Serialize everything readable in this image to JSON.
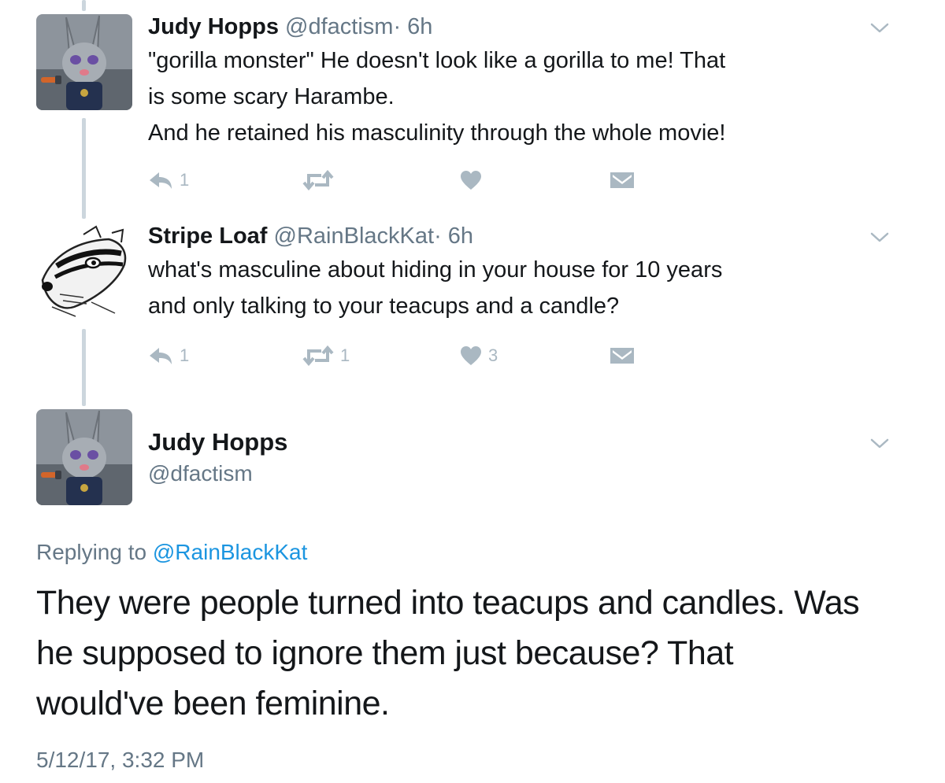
{
  "tweets": [
    {
      "name": "Judy Hopps",
      "handle": "@dfactism",
      "time": "· 6h",
      "lines": [
        "\"gorilla monster\" He doesn't look like a gorilla to me! That",
        "is some scary Harambe.",
        "And he retained his masculinity through the whole movie!"
      ],
      "reply_count": "1",
      "retweet_count": "",
      "like_count": "",
      "avatar_icon": "judy-hopps-avatar"
    },
    {
      "name": "Stripe Loaf",
      "handle": "@RainBlackKat",
      "time": "· 6h",
      "lines": [
        "what's masculine about hiding in your house for 10 years",
        "and only talking to your teacups and a candle?"
      ],
      "reply_count": "1",
      "retweet_count": "1",
      "like_count": "3",
      "avatar_icon": "badger-sketch-avatar"
    }
  ],
  "main_tweet": {
    "name": "Judy Hopps",
    "handle": "@dfactism",
    "replying_prefix": "Replying to",
    "replying_to": "@RainBlackKat",
    "text_lines": [
      "They were people turned into teacups and candles. Was",
      "he supposed to ignore them just because? That",
      "would've been feminine."
    ],
    "timestamp": "5/12/17, 3:32 PM"
  },
  "colors": {
    "text": "#14171a",
    "secondary": "#657786",
    "icon": "#aab8c2",
    "link": "#1b95e0",
    "thread_line": "#ccd6dd"
  }
}
